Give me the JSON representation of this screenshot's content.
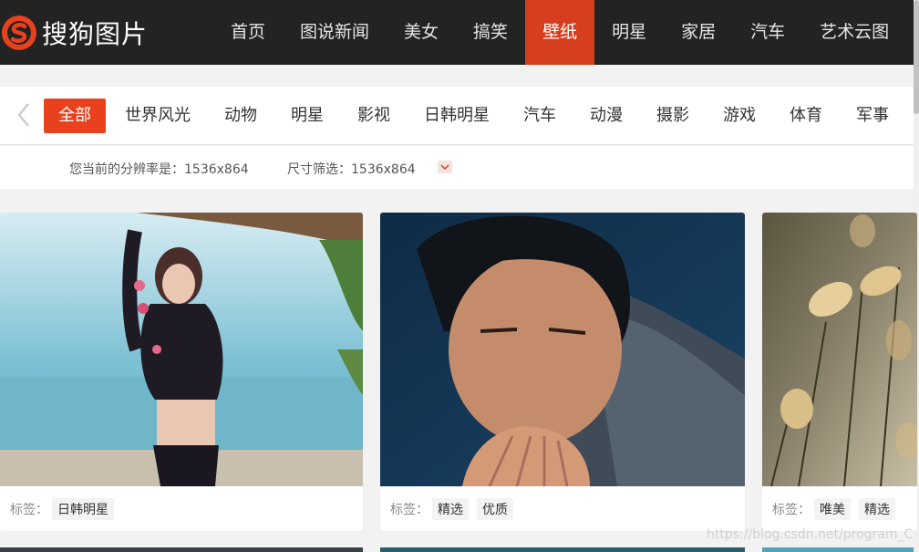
{
  "brand": {
    "name": "搜狗图片",
    "color": "#e8411e"
  },
  "nav": {
    "items": [
      {
        "label": "首页",
        "active": false
      },
      {
        "label": "图说新闻",
        "active": false
      },
      {
        "label": "美女",
        "active": false
      },
      {
        "label": "搞笑",
        "active": false
      },
      {
        "label": "壁纸",
        "active": true
      },
      {
        "label": "明星",
        "active": false
      },
      {
        "label": "家居",
        "active": false
      },
      {
        "label": "汽车",
        "active": false
      },
      {
        "label": "艺术云图",
        "active": false
      }
    ]
  },
  "categories": {
    "prev_icon": "chevron-left-icon",
    "items": [
      {
        "label": "全部",
        "active": true
      },
      {
        "label": "世界风光",
        "active": false
      },
      {
        "label": "动物",
        "active": false
      },
      {
        "label": "明星",
        "active": false
      },
      {
        "label": "影视",
        "active": false
      },
      {
        "label": "日韩明星",
        "active": false
      },
      {
        "label": "汽车",
        "active": false
      },
      {
        "label": "动漫",
        "active": false
      },
      {
        "label": "摄影",
        "active": false
      },
      {
        "label": "游戏",
        "active": false
      },
      {
        "label": "体育",
        "active": false
      },
      {
        "label": "军事",
        "active": false
      }
    ]
  },
  "filter": {
    "resolution_text": "您当前的分辨率是：1536x864",
    "size_text": "尺寸筛选：1536x864",
    "toggle_icon": "chevron-down-icon"
  },
  "cards": [
    {
      "tag_label": "标签：",
      "tags": [
        "日韩明星"
      ],
      "image": "woman-in-swimsuit-by-sea"
    },
    {
      "tag_label": "标签：",
      "tags": [
        "精选",
        "优质"
      ],
      "image": "man-praying-portrait"
    },
    {
      "tag_label": "标签：",
      "tags": [
        "唯美",
        "精选"
      ],
      "image": "fluffy-grass-plants"
    }
  ],
  "watermark": "https://blog.csdn.net/program_C"
}
